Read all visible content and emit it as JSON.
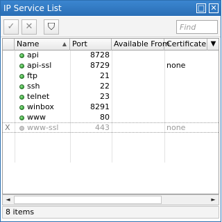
{
  "window": {
    "title": "IP Service List",
    "maximize_glyph": "□",
    "close_glyph": "✕"
  },
  "toolbar": {
    "enable_glyph": "✓",
    "disable_glyph": "✕",
    "filter_glyph": "⛉",
    "find_placeholder": "Find"
  },
  "table": {
    "columns": [
      "Name",
      "Port",
      "Available From",
      "Certificate"
    ],
    "sort_glyph": "▲",
    "menu_glyph": "▼",
    "rows": [
      {
        "mark": "",
        "name": "api",
        "port": "8728",
        "available_from": "",
        "certificate": ""
      },
      {
        "mark": "",
        "name": "api-ssl",
        "port": "8729",
        "available_from": "",
        "certificate": "none"
      },
      {
        "mark": "",
        "name": "ftp",
        "port": "21",
        "available_from": "",
        "certificate": ""
      },
      {
        "mark": "",
        "name": "ssh",
        "port": "22",
        "available_from": "",
        "certificate": ""
      },
      {
        "mark": "",
        "name": "telnet",
        "port": "23",
        "available_from": "",
        "certificate": ""
      },
      {
        "mark": "",
        "name": "winbox",
        "port": "8291",
        "available_from": "",
        "certificate": ""
      },
      {
        "mark": "",
        "name": "www",
        "port": "80",
        "available_from": "",
        "certificate": ""
      },
      {
        "mark": "X",
        "name": "www-ssl",
        "port": "443",
        "available_from": "",
        "certificate": "none"
      }
    ]
  },
  "scroll": {
    "left_glyph": "◄",
    "right_glyph": "►"
  },
  "status": {
    "text": "8 items"
  },
  "colors": {
    "titlebar": "#2f78c2",
    "status_dot": "#1b8f1b",
    "disabled_text": "#9a9a9a"
  }
}
